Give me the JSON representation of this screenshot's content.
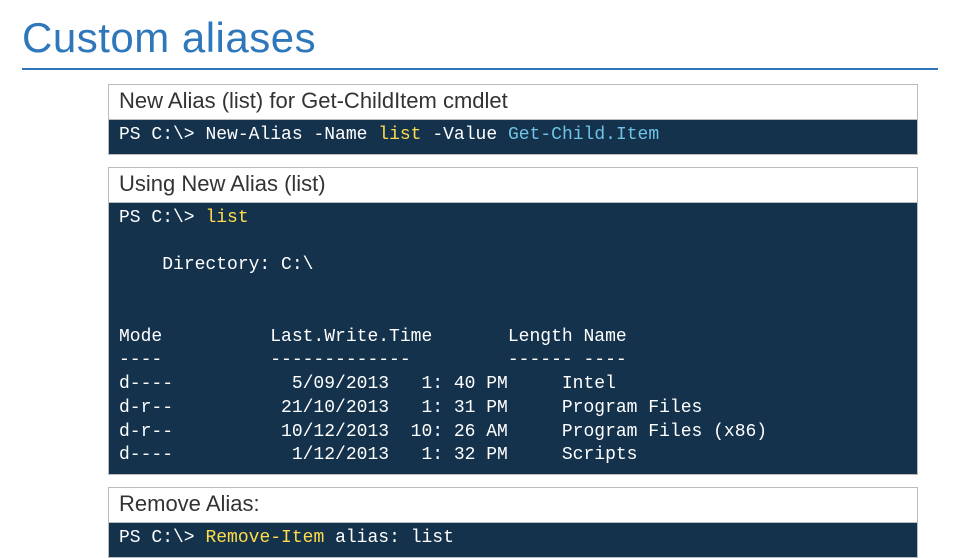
{
  "title": "Custom aliases",
  "section1": {
    "label": "New Alias (list) for Get-ChildItem cmdlet",
    "cmd": {
      "prompt": "PS C:\\>",
      "a": "New-Alias -Name",
      "b": "list",
      "c": "-Value",
      "d": "Get-Child.Item"
    }
  },
  "section2": {
    "label": "Using New Alias (list)",
    "cmd": {
      "prompt": "PS C:\\>",
      "a": "list"
    },
    "out": {
      "dir": "Directory: C:\\",
      "header": "Mode          Last.Write.Time       Length Name",
      "divider": "----          -------------         ------ ----",
      "row0": "d----           5/09/2013   1: 40 PM     Intel",
      "row1": "d-r--          21/10/2013   1: 31 PM     Program Files",
      "row2": "d-r--          10/12/2013  10: 26 AM     Program Files (x86)",
      "row3": "d----           1/12/2013   1: 32 PM     Scripts"
    }
  },
  "section3": {
    "label": "Remove Alias:",
    "cmd": {
      "prompt": "PS C:\\>",
      "a": "Remove-Item",
      "b": "alias: list"
    }
  }
}
